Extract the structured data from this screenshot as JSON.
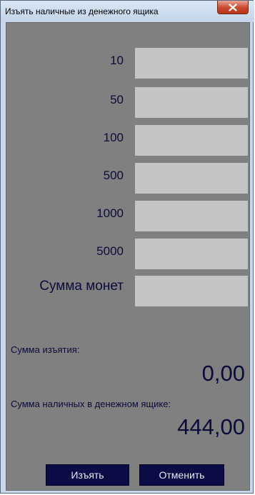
{
  "window": {
    "title": "Изъять наличные из денежного ящика"
  },
  "denominations": [
    {
      "label": "10",
      "value": ""
    },
    {
      "label": "50",
      "value": ""
    },
    {
      "label": "100",
      "value": ""
    },
    {
      "label": "500",
      "value": ""
    },
    {
      "label": "1000",
      "value": ""
    },
    {
      "label": "5000",
      "value": ""
    },
    {
      "label": "Сумма монет",
      "value": ""
    }
  ],
  "summary": {
    "withdrawal_label": "Сумма изъятия:",
    "withdrawal_value": "0,00",
    "drawer_label": "Сумма наличных в денежном ящике:",
    "drawer_value": "444,00"
  },
  "buttons": {
    "withdraw_label": "Изъять",
    "cancel_label": "Отменить"
  },
  "icons": {
    "close": "close-icon"
  },
  "colors": {
    "client_background": "#808080",
    "input_background": "#c4c4c4",
    "text": "#0b0b3a",
    "button_background": "#0b0b45",
    "close_button": "#c8482e"
  }
}
